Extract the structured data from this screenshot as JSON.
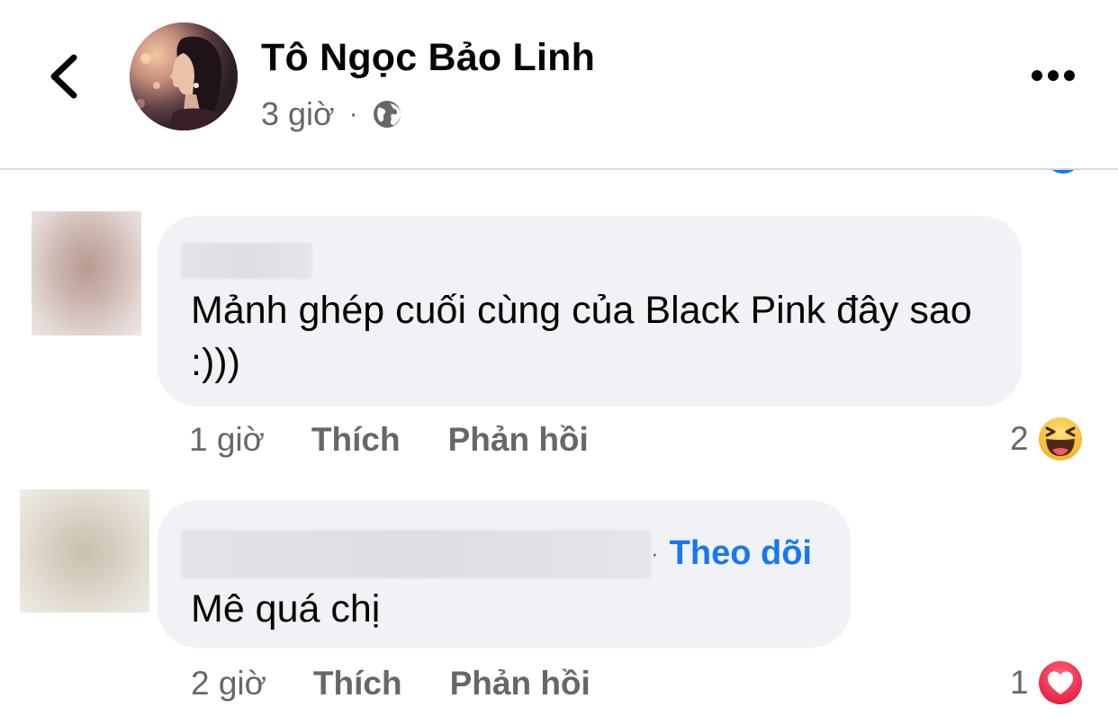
{
  "header": {
    "author_name": "Tô Ngọc Bảo Linh",
    "post_time": "3 giờ",
    "separator": "·",
    "privacy_icon": "globe-icon",
    "back_icon": "chevron-left-icon",
    "more_icon": "more-horizontal-icon"
  },
  "comments": [
    {
      "text": "Mảnh ghép cuối cùng của Black Pink đây sao :)))",
      "time": "1 giờ",
      "like_label": "Thích",
      "reply_label": "Phản hồi",
      "reaction_count": "2",
      "reaction_icon": "haha-reaction-icon"
    },
    {
      "text": "Mê quá chị",
      "follow_separator": "·",
      "follow_label": "Theo dõi",
      "time": "2 giờ",
      "like_label": "Thích",
      "reply_label": "Phản hồi",
      "reaction_count": "1",
      "reaction_icon": "love-reaction-icon"
    }
  ],
  "colors": {
    "link_blue": "#1877f2",
    "secondary_text": "#65676b",
    "bubble_bg": "#f0f2f5"
  }
}
